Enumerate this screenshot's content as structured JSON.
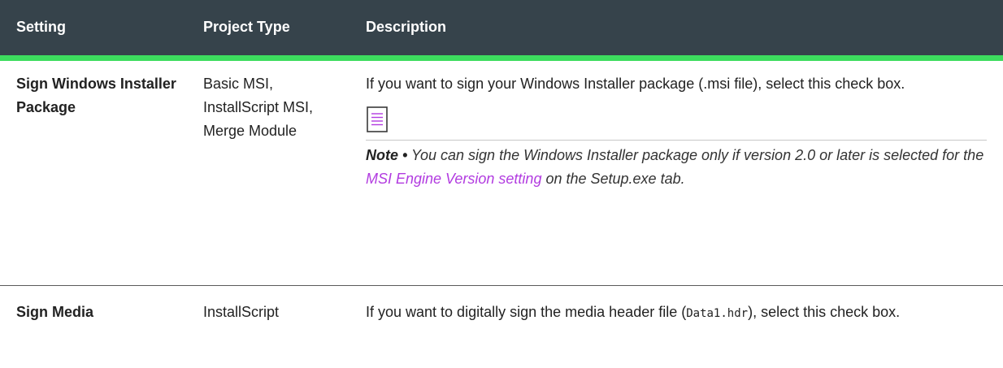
{
  "header": {
    "col_setting": "Setting",
    "col_project_type": "Project Type",
    "col_description": "Description"
  },
  "colors": {
    "header_bg": "#36434b",
    "header_rule": "#3ddc5e",
    "link": "#b23ce0"
  },
  "rows": [
    {
      "setting": "Sign Windows Installer Package",
      "project_type": "Basic MSI, InstallScript MSI, Merge Module",
      "description": "If you want to sign your Windows Installer package (.msi file), select this check box.",
      "note": {
        "icon": "note-icon",
        "label": "Note •",
        "text_before": " You can sign the Windows Installer package only if version 2.0 or later is selected for the ",
        "link_text": "MSI Engine Version setting",
        "text_after": " on the Setup.exe tab."
      }
    },
    {
      "setting": "Sign Media",
      "project_type": "InstallScript",
      "description_before": "If you want to digitally sign the media header file (",
      "description_code": "Data1.hdr",
      "description_after": "), select this check box."
    }
  ]
}
